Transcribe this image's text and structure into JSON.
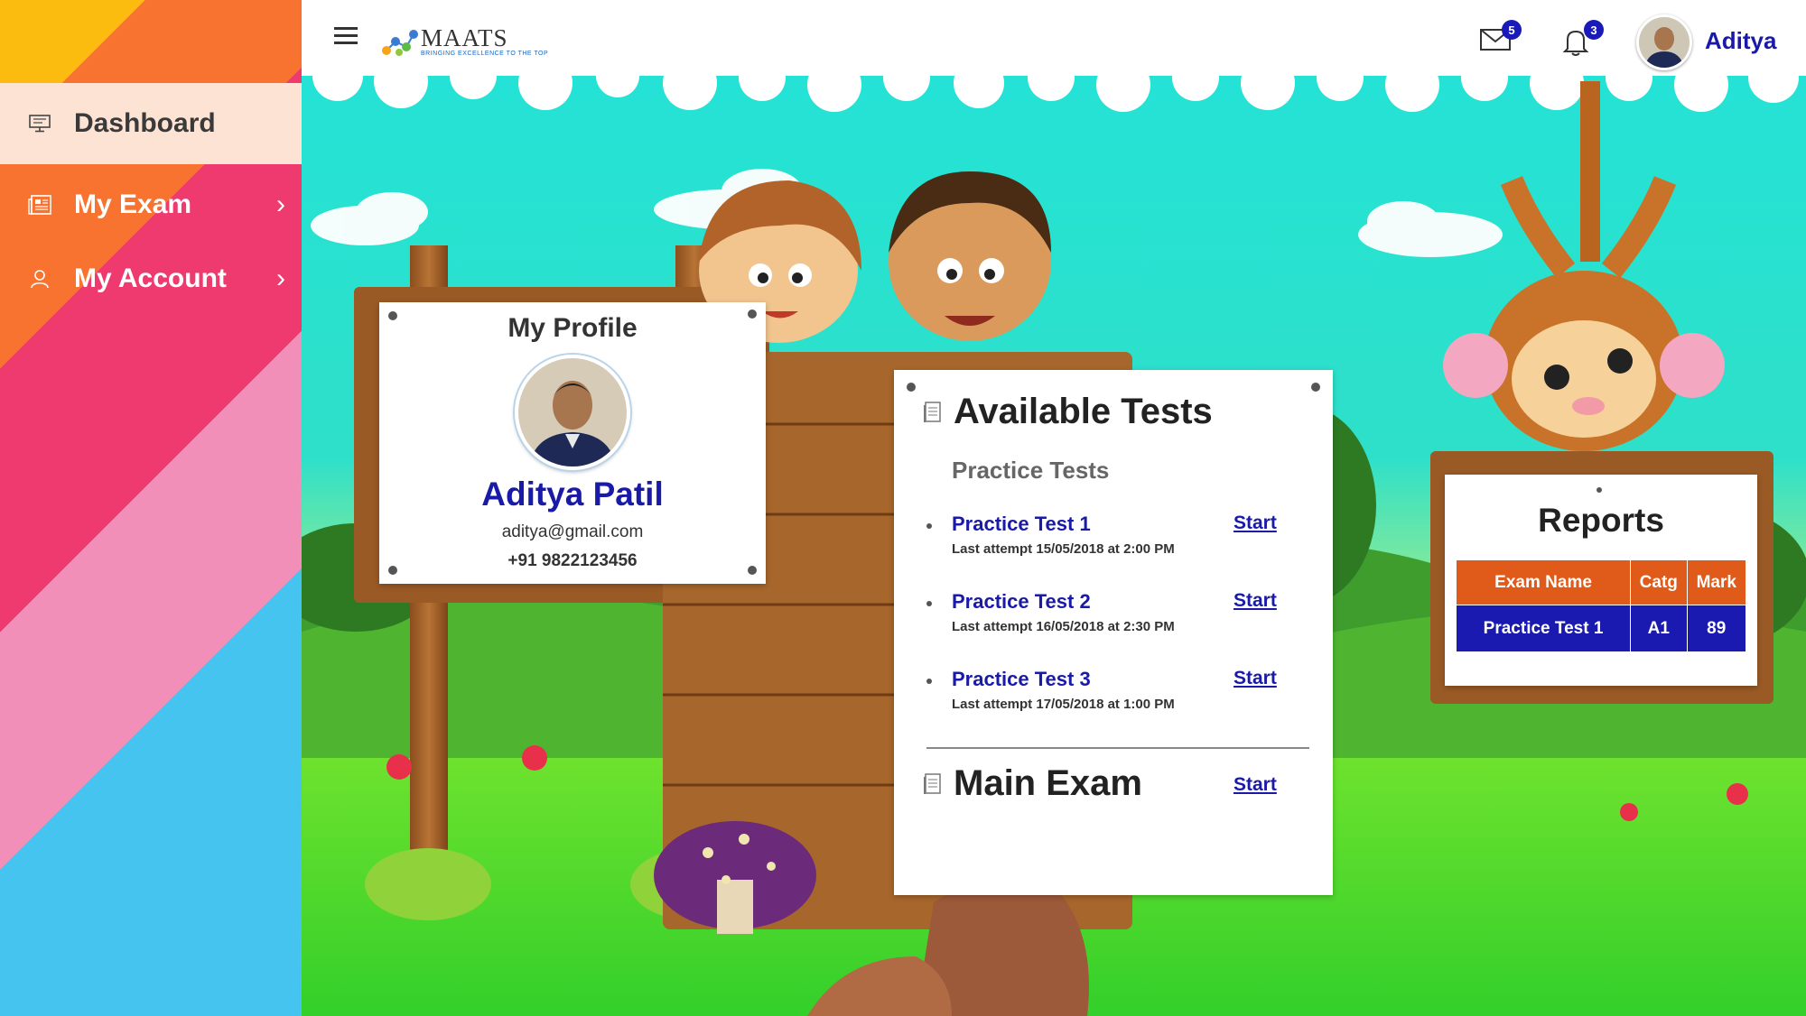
{
  "sidebar": {
    "items": [
      {
        "label": "Dashboard",
        "icon": "monitor-icon",
        "active": true
      },
      {
        "label": "My Exam",
        "icon": "newspaper-icon",
        "active": false
      },
      {
        "label": "My Account",
        "icon": "user-icon",
        "active": false
      }
    ]
  },
  "header": {
    "logo_text": "MAATS",
    "logo_tagline": "BRINGING EXCELLENCE TO THE TOP",
    "mail_count": "5",
    "notification_count": "3",
    "user_name": "Aditya"
  },
  "profile": {
    "title": "My Profile",
    "name": "Aditya Patil",
    "email": "aditya@gmail.com",
    "phone": "+91 9822123456"
  },
  "tests": {
    "title": "Available Tests",
    "subtitle": "Practice Tests",
    "items": [
      {
        "name": "Practice Test 1",
        "last_attempt": "Last attempt 15/05/2018 at 2:00 PM",
        "action": "Start"
      },
      {
        "name": "Practice Test 2",
        "last_attempt": "Last attempt 16/05/2018 at 2:30 PM",
        "action": "Start"
      },
      {
        "name": "Practice Test 3",
        "last_attempt": "Last attempt 17/05/2018 at 1:00 PM",
        "action": "Start"
      }
    ],
    "main_exam": {
      "title": "Main Exam",
      "action": "Start"
    }
  },
  "reports": {
    "title": "Reports",
    "columns": [
      "Exam Name",
      "Catg",
      "Mark"
    ],
    "rows": [
      [
        "Practice Test 1",
        "A1",
        "89"
      ]
    ]
  },
  "colors": {
    "accent_blue": "#1a1aa8",
    "table_header": "#e05a1a",
    "sidebar_active": "#fde3d4"
  }
}
